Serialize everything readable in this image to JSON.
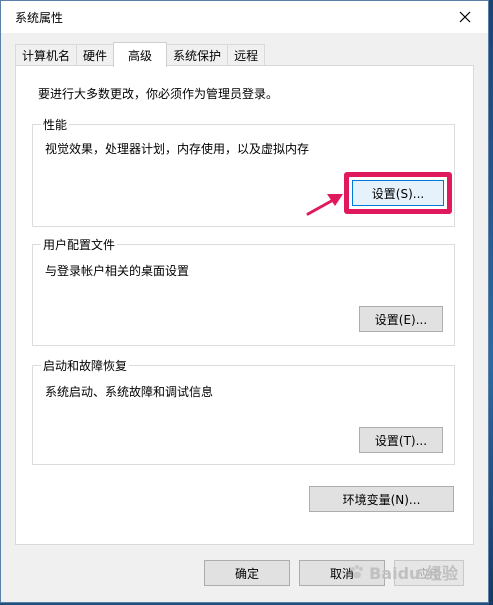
{
  "window": {
    "title": "系统属性"
  },
  "tabs": [
    {
      "label": "计算机名"
    },
    {
      "label": "硬件"
    },
    {
      "label": "高级",
      "active": true
    },
    {
      "label": "系统保护"
    },
    {
      "label": "远程"
    }
  ],
  "intro_text": "要进行大多数更改，你必须作为管理员登录。",
  "performance": {
    "title": "性能",
    "description": "视觉效果，处理器计划，内存使用，以及虚拟内存",
    "button_label": "设置(S)..."
  },
  "user_profiles": {
    "title": "用户配置文件",
    "description": "与登录帐户相关的桌面设置",
    "button_label": "设置(E)..."
  },
  "startup_recovery": {
    "title": "启动和故障恢复",
    "description": "系统启动、系统故障和调试信息",
    "button_label": "设置(T)..."
  },
  "env_button_label": "环境变量(N)...",
  "footer": {
    "ok_label": "确定",
    "cancel_label": "取消",
    "apply_label": "应用"
  },
  "watermark": {
    "text": "Baidu 经验"
  },
  "colors": {
    "highlight": "#e0195f",
    "arrow": "#e0195f"
  },
  "icons": {
    "close": "close-icon",
    "arrow": "arrow-icon"
  }
}
